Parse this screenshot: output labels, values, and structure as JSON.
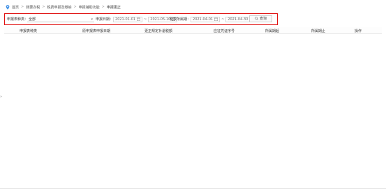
{
  "breadcrumb": {
    "items": [
      "首页",
      "我要办税",
      "税费申报及缴纳",
      "申报辅助功能",
      "申报更正"
    ]
  },
  "filters": {
    "tax_type_label": "申报表种类：",
    "tax_type_value": "全部",
    "declare_date_label": "申报日期：",
    "declare_date_from": "2021-01-01",
    "declare_date_to": "2021-05-10",
    "tax_period_label": "税款所属期：",
    "tax_period_from": "2021-04-01",
    "tax_period_to": "2021-04-30",
    "date_separator": "~",
    "query_button": "查询"
  },
  "table": {
    "columns": [
      "申报表种类",
      "原申报表申报日期",
      "更正规定补退税额",
      "应征凭证序号",
      "所属期起",
      "所属期止",
      "操作"
    ],
    "rows": []
  },
  "side_toggle": "»"
}
